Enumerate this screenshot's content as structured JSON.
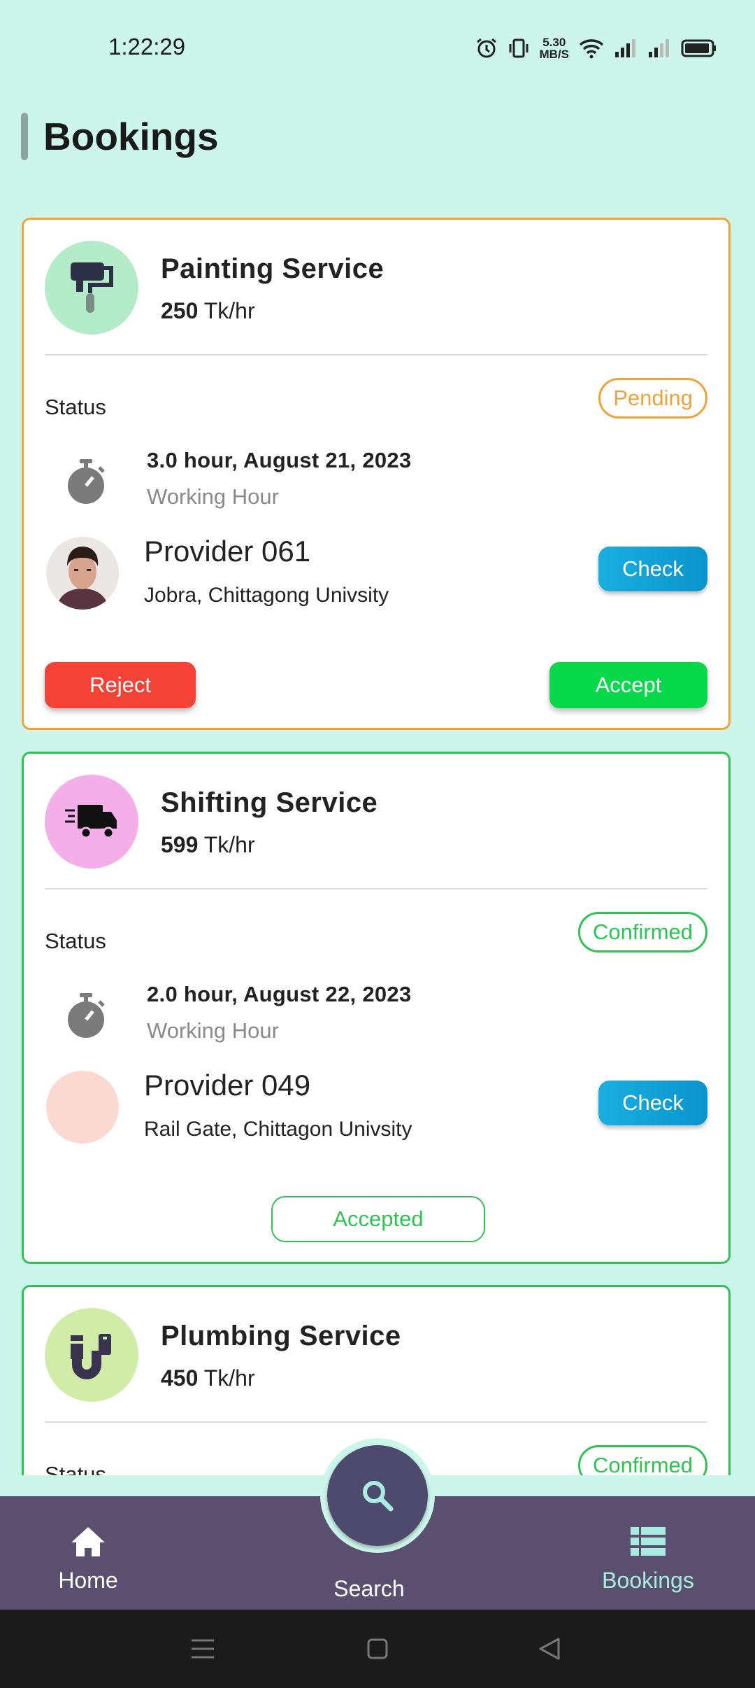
{
  "status_bar": {
    "time": "1:22:29",
    "speed_top": "5.30",
    "speed_bottom": "MB/S"
  },
  "page": {
    "title": "Bookings"
  },
  "bookings": [
    {
      "service": "Painting Service",
      "price_amount": "250",
      "price_unit": "Tk/hr",
      "status_label": "Status",
      "status": "Pending",
      "hours": "3.0 hour, August 21, 2023",
      "hours_label": "Working Hour",
      "provider_name": "Provider 061",
      "provider_address": "Jobra, Chittagong Univsity",
      "check_label": "Check",
      "reject_label": "Reject",
      "accept_label": "Accept",
      "icon": "paint-roller-icon"
    },
    {
      "service": "Shifting Service",
      "price_amount": "599",
      "price_unit": "Tk/hr",
      "status_label": "Status",
      "status": "Confirmed",
      "hours": "2.0 hour, August 22, 2023",
      "hours_label": "Working Hour",
      "provider_name": "Provider 049",
      "provider_address": "Rail Gate, Chittagon Univsity",
      "check_label": "Check",
      "accepted_label": "Accepted",
      "icon": "truck-icon"
    },
    {
      "service": "Plumbing Service",
      "price_amount": "450",
      "price_unit": "Tk/hr",
      "status_label": "Status",
      "status": "Confirmed",
      "icon": "pipe-icon"
    }
  ],
  "bottom_nav": {
    "home": "Home",
    "search": "Search",
    "bookings": "Bookings"
  },
  "colors": {
    "background": "#cdf6ea",
    "pending": "#f0a23a",
    "confirmed": "#2ec454",
    "nav": "#5a4f6e",
    "active_nav": "#a8ede0"
  }
}
